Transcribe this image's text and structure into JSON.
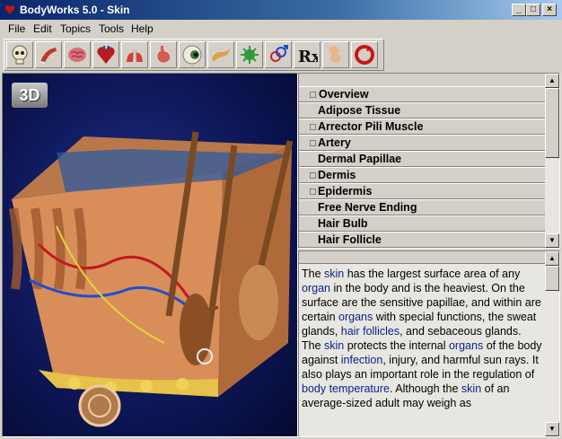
{
  "window": {
    "title": "BodyWorks 5.0 - Skin",
    "controls": {
      "minimize": "_",
      "maximize": "□",
      "close": "×"
    }
  },
  "menu": [
    "File",
    "Edit",
    "Topics",
    "Tools",
    "Help"
  ],
  "toolbar": [
    {
      "icon": "skull-icon"
    },
    {
      "icon": "muscle-icon"
    },
    {
      "icon": "brain-icon"
    },
    {
      "icon": "heart-icon"
    },
    {
      "icon": "lungs-icon"
    },
    {
      "icon": "stomach-icon"
    },
    {
      "icon": "eye-icon"
    },
    {
      "icon": "pancreas-icon"
    },
    {
      "icon": "virus-icon"
    },
    {
      "icon": "gender-icon"
    },
    {
      "icon": "rx-icon",
      "text": "Rx"
    },
    {
      "icon": "fetus-icon"
    },
    {
      "icon": "review-icon"
    }
  ],
  "viewport": {
    "badge": "3D"
  },
  "topics": [
    {
      "label": "Overview",
      "bullet": true,
      "selected": true
    },
    {
      "label": "Adipose Tissue",
      "bullet": false
    },
    {
      "label": "Arrector Pili Muscle",
      "bullet": true
    },
    {
      "label": "Artery",
      "bullet": true
    },
    {
      "label": "Dermal Papillae",
      "bullet": false
    },
    {
      "label": "Dermis",
      "bullet": true
    },
    {
      "label": "Epidermis",
      "bullet": true
    },
    {
      "label": "Free Nerve Ending",
      "bullet": false
    },
    {
      "label": "Hair Bulb",
      "bullet": false
    },
    {
      "label": "Hair Follicle",
      "bullet": false
    }
  ],
  "description": {
    "segments": [
      {
        "t": "The "
      },
      {
        "t": "skin",
        "link": true
      },
      {
        "t": " has the largest surface area of any "
      },
      {
        "t": "organ",
        "link": true
      },
      {
        "t": " in the body and is the heaviest.  On the surface are the sensitive papillae, and within are certain "
      },
      {
        "t": "organs",
        "link": true
      },
      {
        "t": " with special functions, the sweat glands, "
      },
      {
        "t": "hair follicles",
        "link": true
      },
      {
        "t": ", and sebaceous glands.  The "
      },
      {
        "t": "skin",
        "link": true
      },
      {
        "t": " protects the internal "
      },
      {
        "t": "organs",
        "link": true
      },
      {
        "t": " of the body against "
      },
      {
        "t": "infection",
        "link": true
      },
      {
        "t": ", injury, and harmful sun rays.  It also plays an important role in the regulation of "
      },
      {
        "t": "body temperature",
        "link": true
      },
      {
        "t": ".  Although the "
      },
      {
        "t": "skin",
        "link": true
      },
      {
        "t": " of an average-sized adult may weigh as"
      }
    ]
  },
  "colors": {
    "title_bar": "#0a246a",
    "link": "#0a1f8a",
    "viewport_bg": "#0a134d"
  }
}
